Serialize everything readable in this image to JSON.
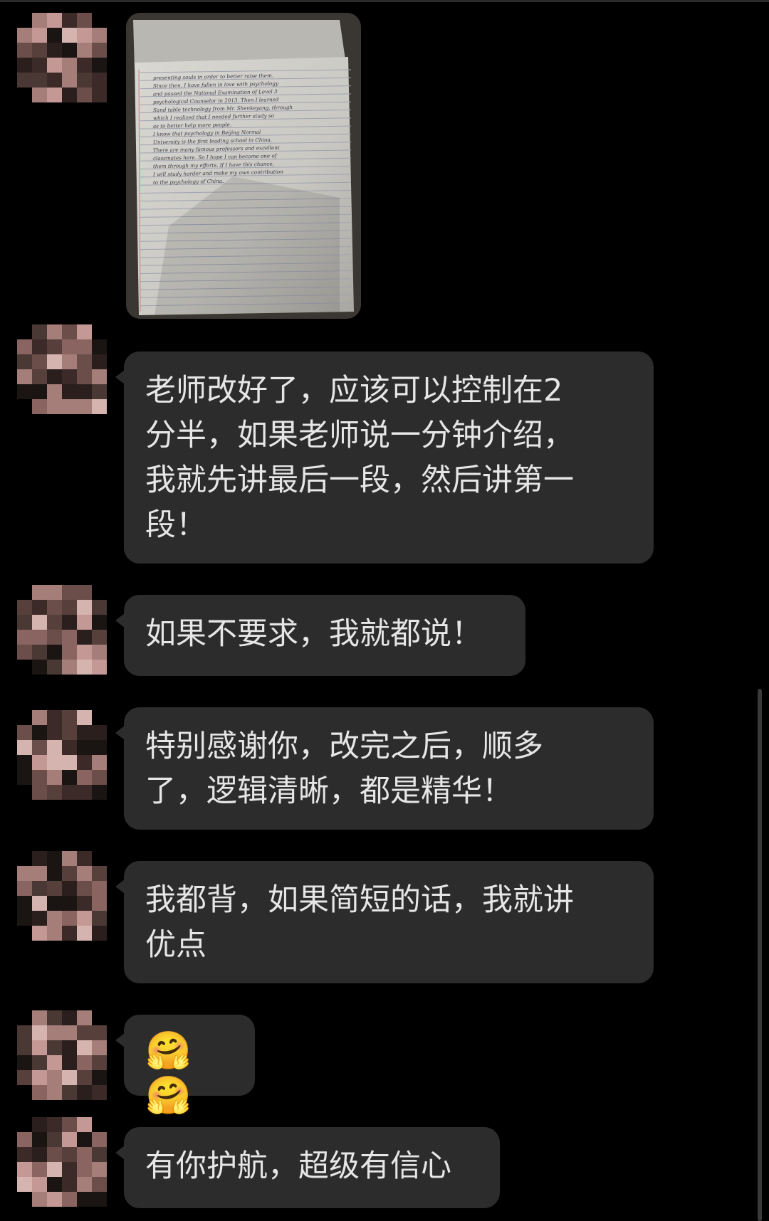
{
  "messages": [
    {
      "type": "image",
      "caption_lines": [
        "presenting souls in order to better raise them.",
        "Since then, I have fallen in love with psychology",
        "and passed the National Examination of Level 3",
        "psychological Counselor in 2013. Then I learned",
        "Sand table technology from Mr. Shenkeyang, through",
        "which I realized that I needed further study so",
        "as to better help more people.",
        "I know that psychology in Beijing Normal",
        "University is the first leading school in China.",
        "There are many famous professors and excellent",
        "classmates here. So I hope I can become one of",
        "them through my efforts. If I have this chance,",
        "I will study harder and make my own contribution",
        "to the psychology of China."
      ]
    },
    {
      "type": "text",
      "text": "老师改好了，应该可以控制在2\n分半，如果老师说一分钟介绍，\n我就先讲最后一段，然后讲第一\n段！"
    },
    {
      "type": "text",
      "text": "如果不要求，我就都说！"
    },
    {
      "type": "text",
      "text": "特别感谢你，改完之后，顺多\n了，逻辑清晰，都是精华！"
    },
    {
      "type": "text",
      "text": "我都背，如果简短的话，我就讲\n优点"
    },
    {
      "type": "emoji",
      "text": "🤗🤗"
    },
    {
      "type": "text",
      "text": "有你护航，超级有信心"
    }
  ],
  "colors": {
    "background": "#000000",
    "bubble": "#2c2c2c",
    "text": "#e6e6e6"
  }
}
